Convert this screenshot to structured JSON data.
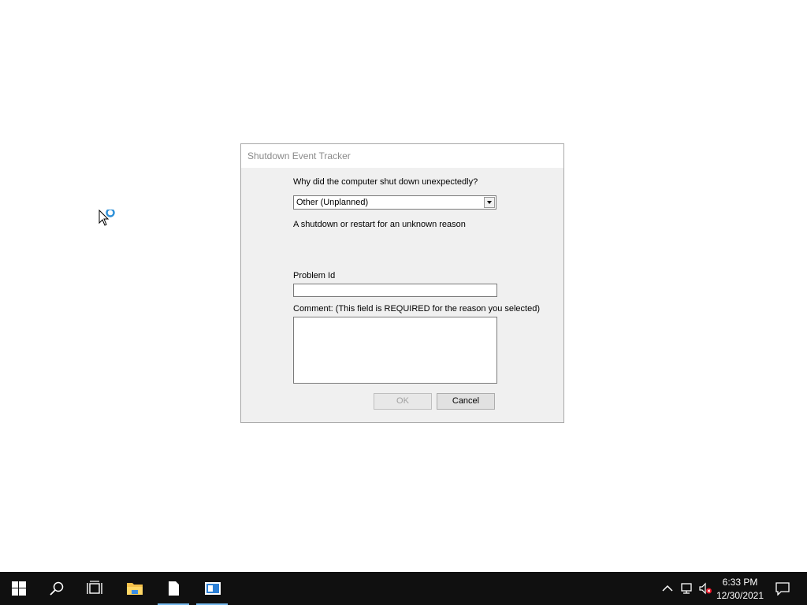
{
  "dialog": {
    "title": "Shutdown Event Tracker",
    "question": "Why did the computer shut down unexpectedly?",
    "reason_selected": "Other (Unplanned)",
    "reason_description": "A shutdown or restart for an unknown reason",
    "problem_id_label": "Problem Id",
    "problem_id_value": "",
    "comment_label": "Comment: (This field is REQUIRED for the reason you selected)",
    "comment_value": "",
    "ok_label": "OK",
    "cancel_label": "Cancel"
  },
  "taskbar": {
    "items": [
      {
        "name": "start-button",
        "icon": "windows-logo-icon"
      },
      {
        "name": "search-button",
        "icon": "search-icon"
      },
      {
        "name": "task-view-button",
        "icon": "task-view-icon"
      },
      {
        "name": "file-explorer-button",
        "icon": "folder-icon"
      },
      {
        "name": "notepad-button",
        "icon": "document-icon"
      },
      {
        "name": "shutdown-tracker-button",
        "icon": "window-app-icon"
      }
    ],
    "tray": {
      "icons": [
        "chevron-up-icon",
        "network-icon",
        "volume-muted-icon",
        "action-center-icon"
      ],
      "time": "6:33 PM",
      "date": "12/30/2021"
    },
    "accent_color": "#76b9ed"
  }
}
